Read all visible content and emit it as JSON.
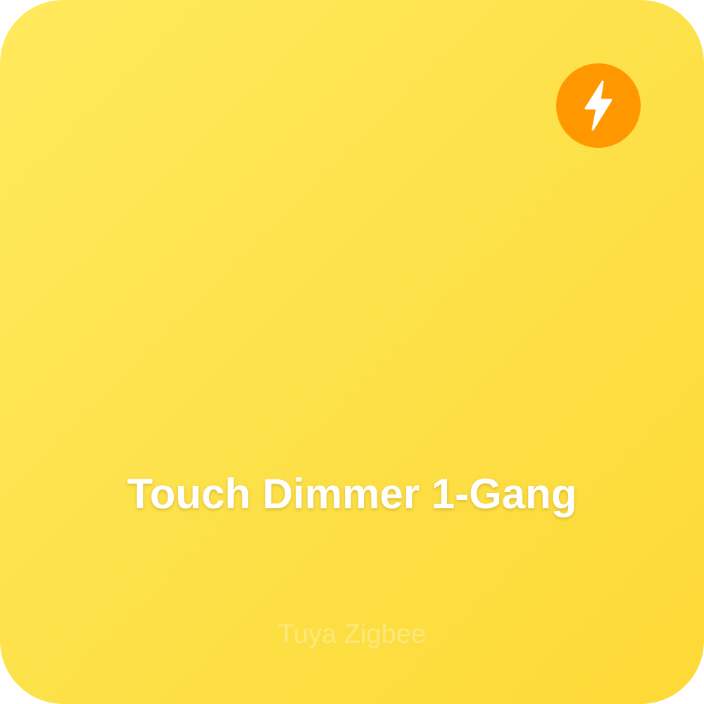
{
  "card": {
    "title": "Touch Dimmer 1-Gang",
    "subtitle": "Tuya Zigbee",
    "badge_icon": "lightning-bolt-icon",
    "colors": {
      "background_start": "#ffea5c",
      "background_end": "#fdd935",
      "badge": "#ff9800",
      "text": "#ffffff"
    }
  }
}
